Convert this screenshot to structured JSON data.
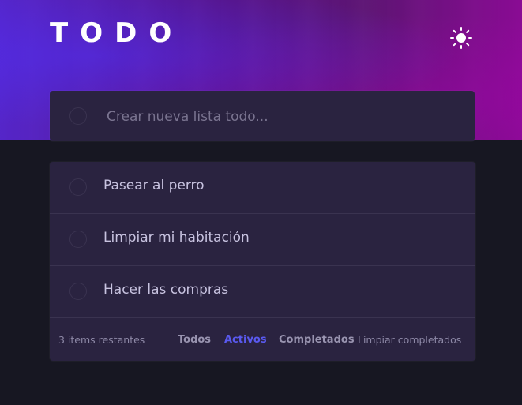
{
  "header": {
    "title": "TODO",
    "theme_icon": "sun-icon"
  },
  "new_todo": {
    "placeholder": "Crear nueva lista todo..."
  },
  "todos": [
    {
      "text": "Pasear al perro"
    },
    {
      "text": "Limpiar mi habitación"
    },
    {
      "text": "Hacer las compras"
    }
  ],
  "footer": {
    "items_left": "3 items restantes",
    "filter_all": "Todos",
    "filter_active": "Activos",
    "filter_completed": "Completados",
    "clear_completed": "Limpiar completados"
  },
  "colors": {
    "background": "#171722",
    "card": "#2a2340",
    "accent": "#5a5af0"
  }
}
